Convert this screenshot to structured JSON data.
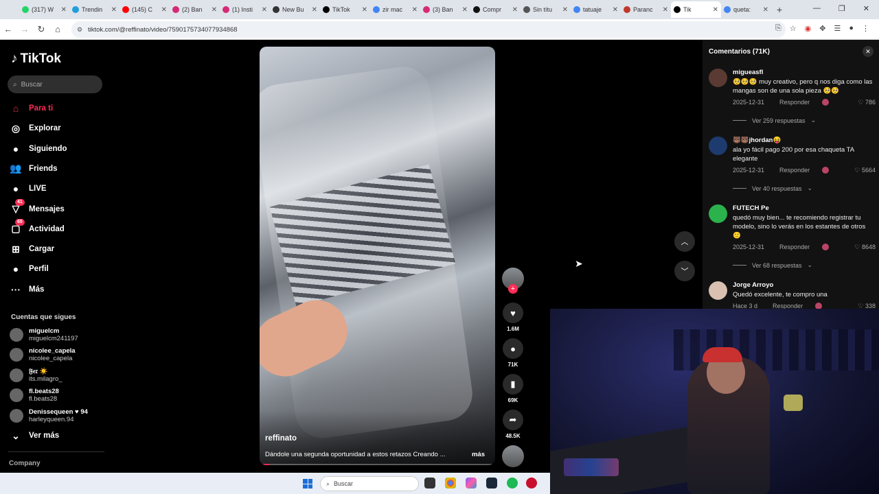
{
  "browser": {
    "tabs": [
      {
        "label": "(317) W",
        "color": "#25d366"
      },
      {
        "label": "Trendin",
        "color": "#229ed9"
      },
      {
        "label": "(145) C",
        "color": "#ff0000"
      },
      {
        "label": "(2) Ban",
        "color": "#d62976"
      },
      {
        "label": "(1) Insti",
        "color": "#d62976"
      },
      {
        "label": "New Bu",
        "color": "#333333"
      },
      {
        "label": "TikTok",
        "color": "#000000"
      },
      {
        "label": "zir mac",
        "color": "#4285f4"
      },
      {
        "label": "(3) Ban",
        "color": "#d62976"
      },
      {
        "label": "Compr",
        "color": "#111111"
      },
      {
        "label": "Sin títu",
        "color": "#555555"
      },
      {
        "label": "tatuaje",
        "color": "#4285f4"
      },
      {
        "label": "Paranc",
        "color": "#c0392b"
      },
      {
        "label": "Tik",
        "color": "#000000",
        "active": true
      },
      {
        "label": "queta:",
        "color": "#4285f4"
      }
    ],
    "url": "tiktok.com/@reffinato/video/7590175734077934868"
  },
  "sidebar": {
    "logo": "TikTok",
    "search_placeholder": "Buscar",
    "nav": [
      {
        "label": "Para ti",
        "icon": "home-icon",
        "glyph": "⌂"
      },
      {
        "label": "Explorar",
        "icon": "compass-icon",
        "glyph": "◎"
      },
      {
        "label": "Siguiendo",
        "icon": "following-avatar-icon",
        "glyph": "●"
      },
      {
        "label": "Friends",
        "icon": "friends-icon",
        "glyph": "👥"
      },
      {
        "label": "LIVE",
        "icon": "live-icon",
        "glyph": "●"
      },
      {
        "label": "Mensajes",
        "icon": "messages-icon",
        "glyph": "▽",
        "badge": "41"
      },
      {
        "label": "Actividad",
        "icon": "activity-icon",
        "glyph": "▢",
        "badge": "65"
      },
      {
        "label": "Cargar",
        "icon": "upload-icon",
        "glyph": "⊞"
      },
      {
        "label": "Perfil",
        "icon": "profile-icon",
        "glyph": "●"
      },
      {
        "label": "Más",
        "icon": "more-icon",
        "glyph": "···"
      }
    ],
    "following_header": "Cuentas que sigues",
    "following": [
      {
        "name": "miguelcm",
        "handle": "miguelcm241197"
      },
      {
        "name": "nicolee_capela",
        "handle": "nicolee_capela"
      },
      {
        "name": "𝔉𝔢𝔯 ☀️",
        "handle": "its.milagro_"
      },
      {
        "name": "fl.beats28",
        "handle": "fl.beats28"
      },
      {
        "name": "Denissequeen ♥ 94",
        "handle": "harleyqueen.94"
      }
    ],
    "see_more": "Ver más",
    "company": "Company"
  },
  "video": {
    "author": "reffinato",
    "description": "Dándole una segunda oportunidad a estos retazos Creando ...",
    "more": "más",
    "progress": 0.04
  },
  "actions": {
    "likes": "1.6M",
    "comments": "71K",
    "saves": "69K",
    "shares": "48.5K"
  },
  "comments": {
    "title": "Comentarios (71K)",
    "reply_label": "Responder",
    "items": [
      {
        "user": "migueasfl",
        "text": "🥺🥺🥺 muy creativo, pero q nos diga como las mangas son de una sola pieza 🥺🥺",
        "date": "2025-12-31",
        "likes": "786",
        "replies": "Ver 259 respuestas"
      },
      {
        "user": "🐻🐻jhordan😝",
        "text": "ala yo fácil pago 200 por esa chaqueta TA elegante",
        "date": "2025-12-31",
        "likes": "5664",
        "replies": "Ver 40 respuestas"
      },
      {
        "user": "FUTECH Pe",
        "text": "quedó muy bien... te recomiendo registrar tu modelo, sino lo verás en los estantes de otros 🙂",
        "date": "2025-12-31",
        "likes": "8648",
        "replies": "Ver 68 respuestas"
      },
      {
        "user": "Jorge Arroyo",
        "text": "Quedó excelente, te compro una",
        "date": "Hace 3 d",
        "likes": "338",
        "replies": ""
      }
    ]
  },
  "taskbar": {
    "search_placeholder": "Buscar"
  },
  "colors": {
    "accent": "#fe2c55",
    "panel": "#121212"
  }
}
